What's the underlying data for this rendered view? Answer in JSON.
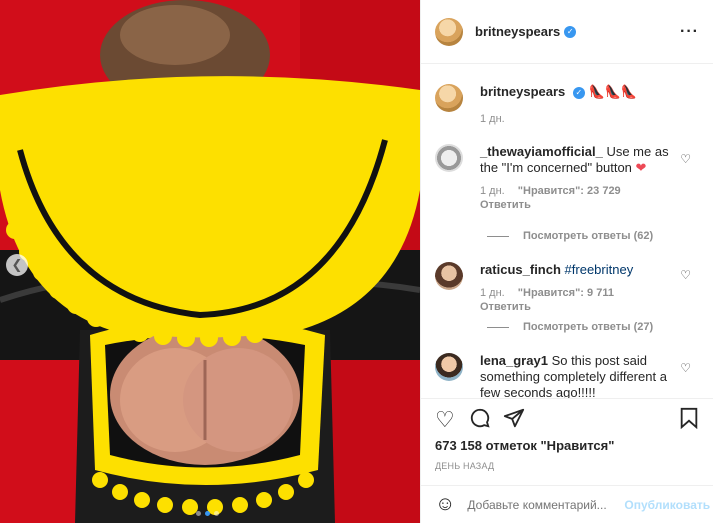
{
  "post": {
    "author": "britneyspears",
    "caption_emoji": "👠👠👠",
    "caption_time": "1 дн."
  },
  "comments": [
    {
      "user": "_thewayiamofficial_",
      "text": "Use me as the \"I'm concerned\" button",
      "emoji": "❤",
      "time": "1 дн.",
      "likes": "\"Нравится\": 23 729",
      "reply": "Ответить",
      "view_replies": "Посмотреть ответы (62)"
    },
    {
      "user": "raticus_finch",
      "text": "#freebritney",
      "time": "1 дн.",
      "likes": "\"Нравится\": 9 711",
      "reply": "Ответить",
      "view_replies": "Посмотреть ответы (27)"
    },
    {
      "user": "lena_gray1",
      "text": "So this post said something completely different a few seconds ago!!!!!"
    }
  ],
  "likes_count": "673 158 отметок \"Нравится\"",
  "date_label": "ДЕНЬ НАЗАД",
  "composer": {
    "placeholder": "Добавьте комментарий...",
    "publish": "Опубликовать"
  },
  "icons": {
    "more": "more-icon",
    "like": "heart-icon",
    "comment": "comment-icon",
    "share": "share-icon",
    "save": "bookmark-icon",
    "emoji": "emoji-icon"
  },
  "colors": {
    "accent": "#3897f0",
    "background_red": "#d10d1a",
    "flag_yellow": "#ffe600"
  }
}
